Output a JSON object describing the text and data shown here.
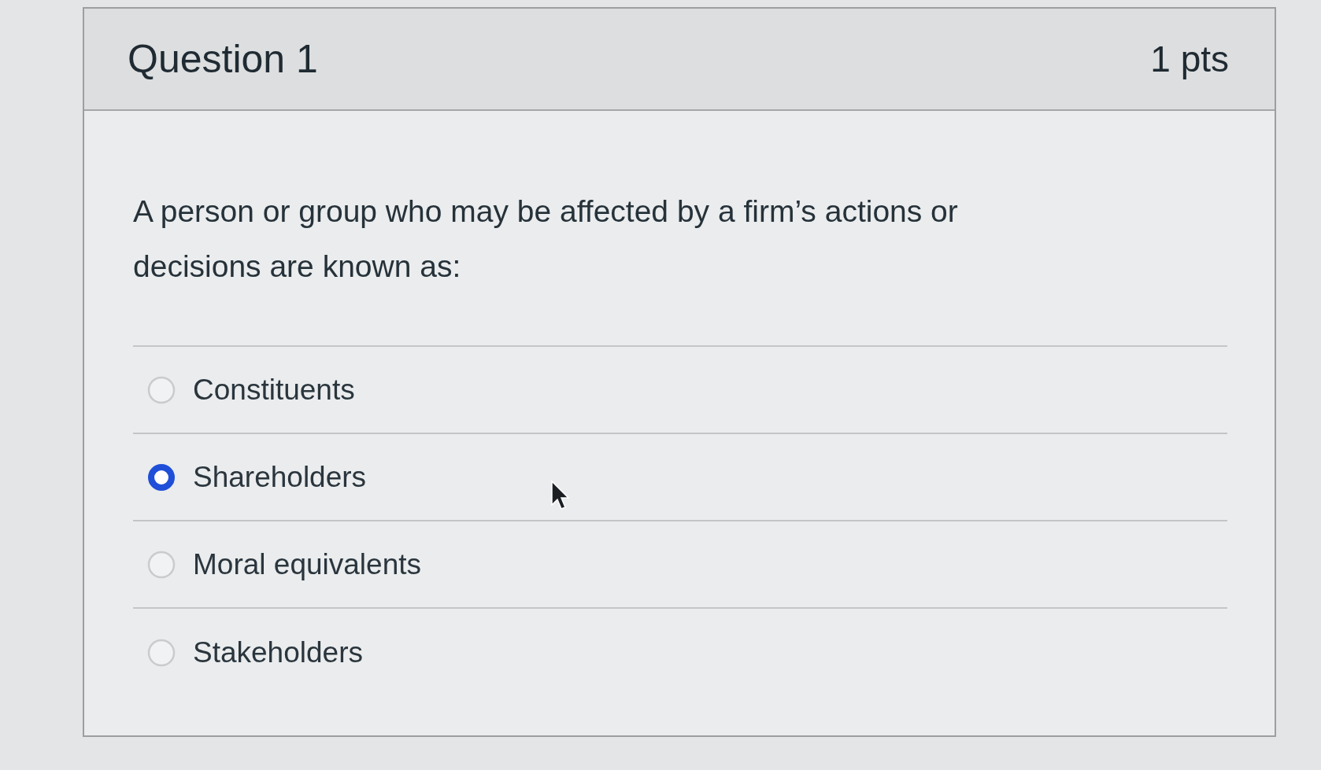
{
  "question": {
    "title": "Question 1",
    "points": "1 pts",
    "text": "A person or group who may be affected by a firm’s actions or decisions are known as:"
  },
  "answers": [
    {
      "label": "Constituents",
      "selected": false
    },
    {
      "label": "Shareholders",
      "selected": true
    },
    {
      "label": "Moral equivalents",
      "selected": false
    },
    {
      "label": "Stakeholders",
      "selected": false
    }
  ]
}
